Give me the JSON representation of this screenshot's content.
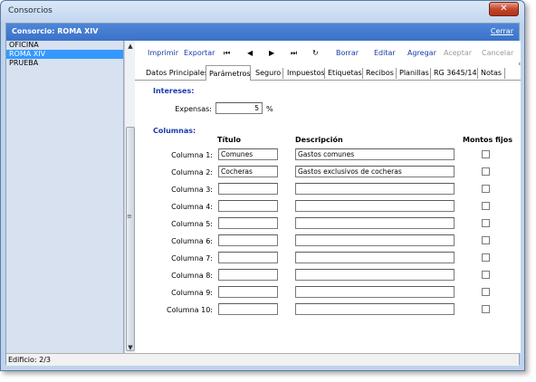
{
  "window": {
    "title": "Consorcios",
    "close_glyph": "✕"
  },
  "header": {
    "title": "Consorcio:  ROMA XIV",
    "close_link": "Cerrar"
  },
  "list": {
    "items": [
      "OFICINA",
      "ROMA XIV",
      "PRUEBA"
    ],
    "selected_index": 1
  },
  "scrollbar": {
    "up_glyph": "▲",
    "down_glyph": "▼",
    "grip_glyph": "≡"
  },
  "toolbar": {
    "imprimir": "Imprimir",
    "exportar": "Exportar",
    "first": "⏮",
    "prev": "◀",
    "next": "▶",
    "last": "⏭",
    "refresh": "↻",
    "borrar": "Borrar",
    "editar": "Editar",
    "agregar": "Agregar",
    "aceptar": "Aceptar",
    "cancelar": "Cancelar"
  },
  "tabs": [
    "Datos Principales",
    "Parámetros",
    "Seguro",
    "Impuestos",
    "Etiquetas",
    "Recibos",
    "Planillas",
    "RG 3645/14",
    "Notas"
  ],
  "active_tab": "Parámetros",
  "intereses": {
    "title": "Intereses:",
    "expensas_label": "Expensas:",
    "expensas_value": "5",
    "unit": "%"
  },
  "columnas": {
    "title": "Columnas:",
    "head_titulo": "Título",
    "head_descripcion": "Descripción",
    "head_montos": "Montos fijos",
    "rows": [
      {
        "label": "Columna 1:",
        "titulo": "Comunes",
        "descripcion": "Gastos comunes",
        "monto_fijo": false
      },
      {
        "label": "Columna 2:",
        "titulo": "Cocheras",
        "descripcion": "Gastos exclusivos de cocheras",
        "monto_fijo": false
      },
      {
        "label": "Columna 3:",
        "titulo": "",
        "descripcion": "",
        "monto_fijo": false
      },
      {
        "label": "Columna 4:",
        "titulo": "",
        "descripcion": "",
        "monto_fijo": false
      },
      {
        "label": "Columna 5:",
        "titulo": "",
        "descripcion": "",
        "monto_fijo": false
      },
      {
        "label": "Columna 6:",
        "titulo": "",
        "descripcion": "",
        "monto_fijo": false
      },
      {
        "label": "Columna 7:",
        "titulo": "",
        "descripcion": "",
        "monto_fijo": false
      },
      {
        "label": "Columna 8:",
        "titulo": "",
        "descripcion": "",
        "monto_fijo": false
      },
      {
        "label": "Columna 9:",
        "titulo": "",
        "descripcion": "",
        "monto_fijo": false
      },
      {
        "label": "Columna 10:",
        "titulo": "",
        "descripcion": "",
        "monto_fijo": false
      }
    ]
  },
  "status": {
    "text": "Edificio: 2/3"
  },
  "colors": {
    "header": "#3a72c9",
    "link": "#1a3aa8",
    "selection": "#3399ff",
    "list_bg": "#d7e1ef"
  }
}
